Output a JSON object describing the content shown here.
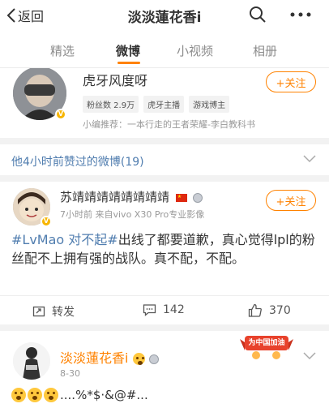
{
  "header": {
    "back_label": "返回",
    "title": "淡淡蓮花香i"
  },
  "tabs": [
    {
      "label": "精选"
    },
    {
      "label": "微博"
    },
    {
      "label": "小视频"
    },
    {
      "label": "相册"
    }
  ],
  "active_tab_index": 1,
  "profile_card": {
    "name": "虎牙风度呀",
    "follow_label": "+关注",
    "tags": [
      "粉丝数 2.9万",
      "虎牙主播",
      "游戏博主"
    ],
    "recommendation": "小编推荐：一本行走的王者荣耀-李白教科书"
  },
  "liked_section": {
    "title": "他4小时前赞过的微博(19)"
  },
  "post": {
    "author": "苏靖靖靖靖靖靖靖靖",
    "follow_label": "+关注",
    "meta": "7小时前  来自vivo X30 Pro专业影像",
    "hashtag": "#LvMao 对不起#",
    "text": "出线了都要道歉，真心觉得lpl的粉丝配不上拥有强的战队。真不配，不配。",
    "repost_label": "转发",
    "comment_count": "142",
    "like_count": "370"
  },
  "post2": {
    "author": "淡淡蓮花香i",
    "date": "8-30",
    "text": "....%*$·&@#...",
    "ribbon_text": "为中国加油"
  },
  "colors": {
    "accent": "#ff8200",
    "link": "#507daf",
    "background": "#f2f2f2"
  },
  "icons": {
    "back": "chevron-left-icon",
    "search": "search-icon",
    "more": "more-dots-icon",
    "repost": "repost-icon",
    "comment": "comment-icon",
    "like": "thumbs-up-icon",
    "expand": "chevron-down-icon"
  }
}
